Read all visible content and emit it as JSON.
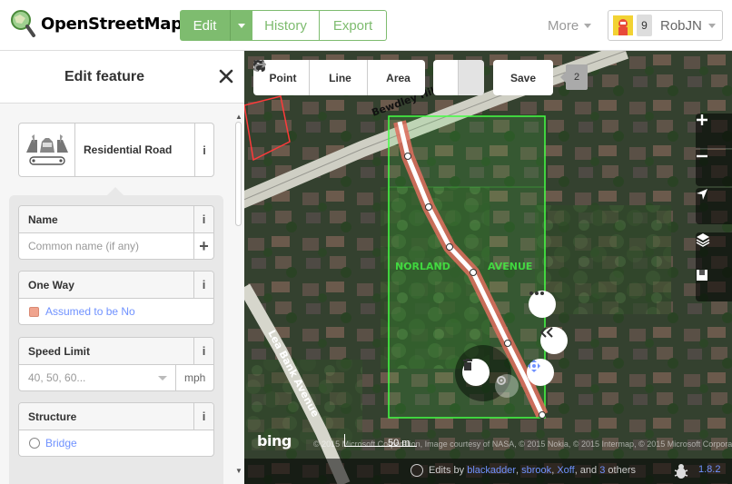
{
  "header": {
    "logo_text": "OpenStreetMap",
    "edit_label": "Edit",
    "history_label": "History",
    "export_label": "Export",
    "more_label": "More",
    "user": {
      "name": "RobJN",
      "count": "9"
    }
  },
  "sidebar": {
    "title": "Edit feature",
    "preset": {
      "name": "Residential Road",
      "info": "i",
      "icon": "road-preset-icon"
    },
    "fields": {
      "name": {
        "label": "Name",
        "placeholder": "Common name (if any)",
        "info": "i",
        "add": "+"
      },
      "oneway": {
        "label": "One Way",
        "value": "Assumed to be No",
        "info": "i"
      },
      "speed": {
        "label": "Speed Limit",
        "placeholder": "40, 50, 60...",
        "unit": "mph",
        "info": "i"
      },
      "structure": {
        "label": "Structure",
        "option": "Bridge",
        "info": "i"
      }
    }
  },
  "map": {
    "toolbar": {
      "point": "Point",
      "line": "Line",
      "area": "Area",
      "save": "Save",
      "save_count": "2"
    },
    "labels": {
      "road1": "Bewdley Hill",
      "road2": "Lea Bank Avenue",
      "road3": "AVENUE",
      "road4": "NORLAND"
    },
    "footer": {
      "bing": "bing",
      "scale": "50 m",
      "attribution": "© 2015 Microsoft Corporation, Image courtesy of NASA, © 2015 Nokia, © 2015 Intermap, © 2015 Microsoft Corporation",
      "edits_prefix": "Edits by",
      "editors": [
        "blackadder",
        "sbrook",
        "Xoff"
      ],
      "and_text": ", and",
      "others_count": "3",
      "others_text": "others",
      "version": "1.8.2"
    },
    "colors": {
      "accent": "#7ebc6f",
      "link": "#7092ff",
      "selected_road": "#e06e5f",
      "area_outline": "#44ff44"
    }
  }
}
